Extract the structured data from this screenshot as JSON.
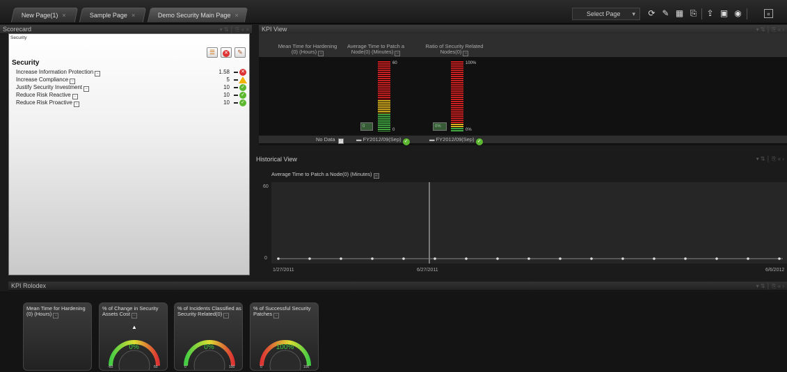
{
  "tabs": [
    {
      "label": "New Page(1)",
      "close": "×"
    },
    {
      "label": "Sample Page",
      "close": "×"
    },
    {
      "label": "Demo Security Main Page",
      "close": "×"
    }
  ],
  "toolbar": {
    "select_page": "Select Page"
  },
  "scorecard": {
    "panel_title": "Scorecard",
    "breadcrumb": "Security",
    "section_title": "Security",
    "rows": [
      {
        "label": "Increase Information Protection",
        "value": "1.58",
        "status": "red"
      },
      {
        "label": "Increase Compliance",
        "value": "5",
        "status": "warning"
      },
      {
        "label": "Justify Security Investment",
        "value": "10",
        "status": "green"
      },
      {
        "label": "Reduce Risk Reactive",
        "value": "10",
        "status": "green"
      },
      {
        "label": "Reduce Risk Proactive",
        "value": "10",
        "status": "green"
      }
    ]
  },
  "kpi_view": {
    "panel_title": "KPI View",
    "columns": [
      {
        "label": "Mean Time for Hardening\n(0) (Hours)",
        "status": "No Data"
      },
      {
        "label": "Average Time to Patch a\nNode(0) (Minutes)",
        "max": "60",
        "min": "0",
        "box": "0",
        "status": "FY2012/09(Sep)"
      },
      {
        "label": "Ratio of Security Related\nNodes(0)",
        "max": "100%",
        "min": "0%",
        "box": "0%",
        "status": "FY2012/09(Sep)"
      }
    ]
  },
  "historical": {
    "panel_title": "Historical View",
    "chart_title": "Average Time to Patch a Node(0) (Minutes)",
    "y_max": "60",
    "y_min": "0",
    "dates": [
      "1/27/2011",
      "6/27/2011",
      "6/6/2012"
    ]
  },
  "rolodex": {
    "panel_title": "KPI Rolodex",
    "cards": [
      {
        "title": "Mean Time for Hardening (0) (Hours)"
      },
      {
        "title": "% of Change in Security Assets Cost",
        "value": "0%",
        "min": "-60",
        "max": "60"
      },
      {
        "title": "% of Incidents Classified as Security Related(0)",
        "value": "0%",
        "min": "0",
        "max": "100"
      },
      {
        "title": "% of Successful Security Patches",
        "value": "100%",
        "min": "0",
        "max": "100"
      }
    ]
  }
}
